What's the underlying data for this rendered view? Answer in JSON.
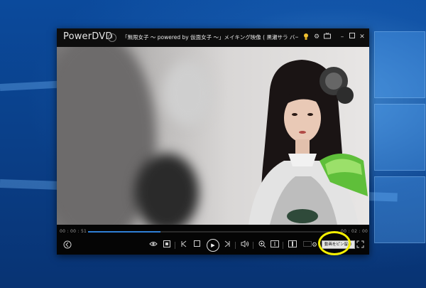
{
  "window": {
    "brand": "PowerDVD",
    "title": "「無限女子 ～ powered by 仮面女子 ～」メイキング映像 ( 黒瀬サラ バージョン)..."
  },
  "titlebar_icons": [
    "lightbulb-icon",
    "gear-icon",
    "tv-icon",
    "minimize-icon",
    "maximize-icon",
    "close-icon"
  ],
  "playback": {
    "current_time": "00 : 00 : 51",
    "total_time": "00 : 02 : 00",
    "progress": 0.29
  },
  "controls": {
    "tooltip": "動画をピン留め"
  },
  "colors": {
    "seek_fill": "#2f7fd6",
    "highlight": "#f6f000"
  }
}
